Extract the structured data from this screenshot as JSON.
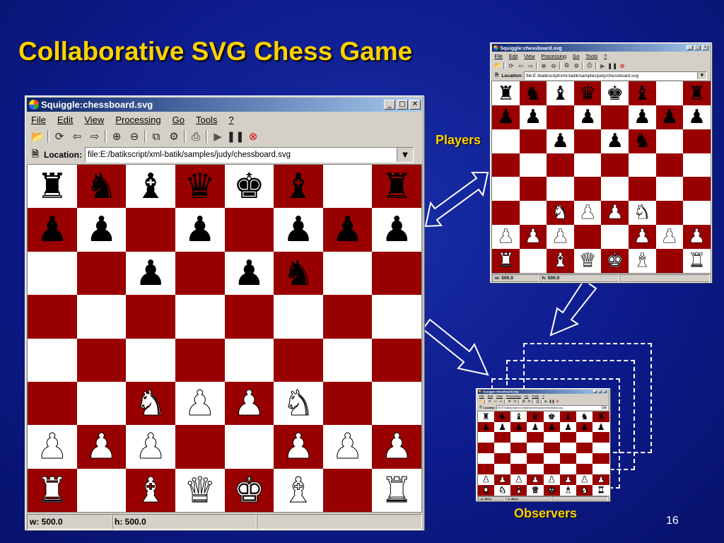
{
  "slide": {
    "title": "Collaborative SVG Chess Game",
    "players_label": "Players",
    "observers_label": "Observers",
    "page_number": "16"
  },
  "window": {
    "title": "Squiggle:chessboard.svg",
    "controls": [
      "_",
      "□",
      "✕"
    ],
    "menus": [
      "File",
      "Edit",
      "View",
      "Processing",
      "Go",
      "Tools",
      "?"
    ],
    "toolbar_icons": [
      "open-icon",
      "reload-icon",
      "back-icon",
      "forward-icon",
      "zoom-in-icon",
      "zoom-out-icon",
      "view-source-icon",
      "dom-viewer-icon",
      "print-icon",
      "play-icon",
      "pause-icon",
      "stop-icon"
    ],
    "location_label": "Location:",
    "location_value": "file:E:/batikscript/xml-batik/samples/judy/chessboard.svg",
    "status_width": "w: 500.0",
    "status_height": "h: 500.0"
  },
  "colors": {
    "dark_square": "#990000",
    "light_square": "#ffffff",
    "title": "#ffd200",
    "background": "#0d1b8c"
  },
  "board": {
    "rows": [
      [
        "br",
        "bn",
        "bb",
        "bq",
        "bk",
        "bb",
        "",
        "br"
      ],
      [
        "bp",
        "bp",
        "",
        "bp",
        "",
        "bp",
        "bp",
        "bp"
      ],
      [
        "",
        "",
        "bp",
        "",
        "bp",
        "bn",
        "",
        ""
      ],
      [
        "",
        "",
        "",
        "",
        "",
        "",
        "",
        ""
      ],
      [
        "",
        "",
        "",
        "",
        "",
        "",
        "",
        ""
      ],
      [
        "",
        "",
        "wn",
        "wp",
        "wp",
        "wn",
        "",
        ""
      ],
      [
        "wp",
        "wp",
        "wp",
        "",
        "",
        "wp",
        "wp",
        "wp"
      ],
      [
        "wr",
        "",
        "wb",
        "wq",
        "wk",
        "wb",
        "",
        "wr"
      ]
    ]
  },
  "observer_board": {
    "rows": [
      [
        "br",
        "bn",
        "bb",
        "bq",
        "bk",
        "bb",
        "bn",
        "br"
      ],
      [
        "bp",
        "bp",
        "bp",
        "bp",
        "bp",
        "bp",
        "bp",
        "bp"
      ],
      [
        "",
        "",
        "",
        "",
        "",
        "",
        "",
        ""
      ],
      [
        "",
        "",
        "",
        "",
        "",
        "",
        "",
        ""
      ],
      [
        "",
        "",
        "",
        "",
        "",
        "",
        "",
        ""
      ],
      [
        "",
        "",
        "",
        "",
        "",
        "",
        "",
        ""
      ],
      [
        "wp",
        "wp",
        "wp",
        "wp",
        "wp",
        "wp",
        "wp",
        "wp"
      ],
      [
        "wr",
        "wn",
        "wb",
        "wq",
        "wk",
        "wb",
        "wn",
        "wr"
      ]
    ]
  }
}
